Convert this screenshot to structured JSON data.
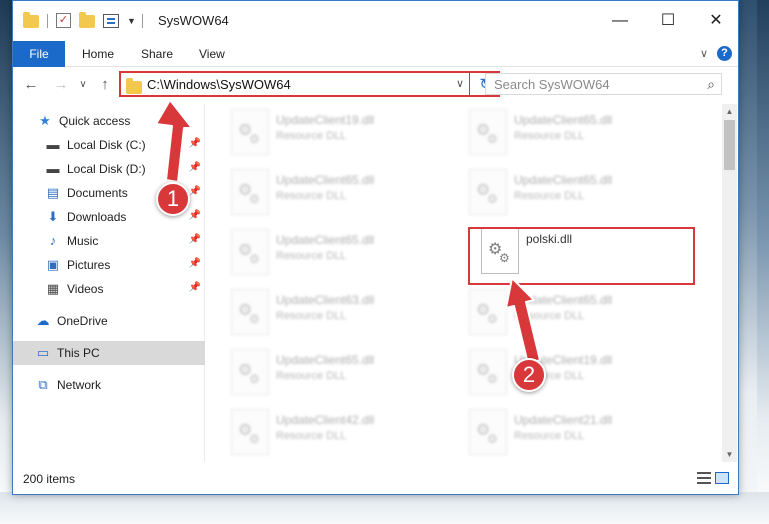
{
  "window": {
    "title": "SysWOW64",
    "minimize_glyph": "—",
    "maximize_glyph": "☐",
    "close_glyph": "✕"
  },
  "ribbon": {
    "tabs": [
      "File",
      "Home",
      "Share",
      "View"
    ],
    "expand_glyph": "∨",
    "help_glyph": "?"
  },
  "nav": {
    "back_glyph": "←",
    "forward_glyph": "→",
    "recent_glyph": "∨",
    "up_glyph": "↑",
    "address": "C:\\Windows\\SysWOW64",
    "address_dropdown_glyph": "∨",
    "refresh_glyph": "↻",
    "search_placeholder": "Search SysWOW64",
    "search_glyph": "⌕"
  },
  "sidebar": {
    "items": [
      {
        "label": "Quick access",
        "icon": "star-icon"
      },
      {
        "label": "Local Disk (C:)",
        "icon": "drive-icon",
        "pinned": true
      },
      {
        "label": "Local Disk (D:)",
        "icon": "drive-icon",
        "pinned": true
      },
      {
        "label": "Documents",
        "icon": "documents-icon",
        "pinned": true
      },
      {
        "label": "Downloads",
        "icon": "downloads-icon",
        "pinned": true
      },
      {
        "label": "Music",
        "icon": "music-icon",
        "pinned": true
      },
      {
        "label": "Pictures",
        "icon": "pictures-icon",
        "pinned": true
      },
      {
        "label": "Videos",
        "icon": "videos-icon",
        "pinned": true
      },
      {
        "label": "OneDrive",
        "icon": "onedrive-icon"
      },
      {
        "label": "This PC",
        "icon": "this-pc-icon",
        "selected": true
      },
      {
        "label": "Network",
        "icon": "network-icon"
      }
    ],
    "pin_glyph": "📌"
  },
  "files": [
    {
      "name": "UpdateClient19.dll",
      "type": "Resource DLL"
    },
    {
      "name": "UpdateClient65.dll",
      "type": "Resource DLL"
    },
    {
      "name": "UpdateClient65.dll",
      "type": "Resource DLL"
    },
    {
      "name": "UpdateClient65.dll",
      "type": "Resource DLL"
    },
    {
      "name": "UpdateClient65.dll",
      "type": "Resource DLL"
    },
    {
      "name": "polski.dll",
      "type": ""
    },
    {
      "name": "UpdateClient63.dll",
      "type": "Resource DLL"
    },
    {
      "name": "UpdateClient65.dll",
      "type": "Resource DLL"
    },
    {
      "name": "UpdateClient65.dll",
      "type": "Resource DLL"
    },
    {
      "name": "UpdateClient19.dll",
      "type": "Resource DLL"
    },
    {
      "name": "UpdateClient42.dll",
      "type": "Resource DLL"
    },
    {
      "name": "UpdateClient21.dll",
      "type": "Resource DLL"
    }
  ],
  "annotations": {
    "step1": "1",
    "step2": "2",
    "accent_color": "#d9383b"
  },
  "status": {
    "item_count": "200 items"
  },
  "colors": {
    "file_tab": "#1b6ac9",
    "selected_nav": "#d9d9d9"
  }
}
